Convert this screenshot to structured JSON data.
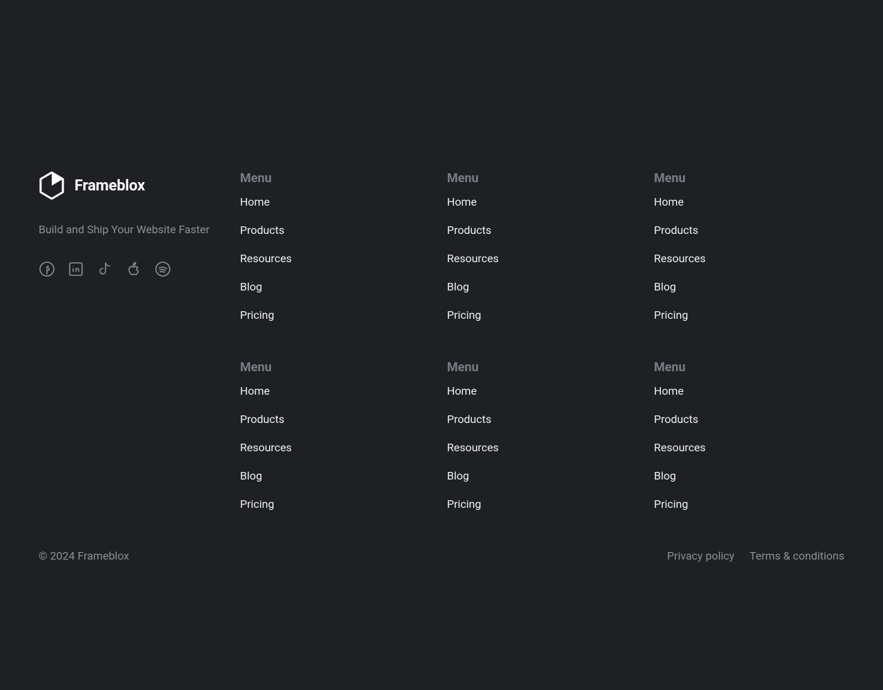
{
  "brand": {
    "name": "Frameblox",
    "tagline": "Build and Ship Your Website Faster"
  },
  "social": {
    "facebook_aria": "Facebook",
    "linkedin_aria": "LinkedIn",
    "tiktok_aria": "TikTok",
    "apple_aria": "Apple",
    "spotify_aria": "Spotify"
  },
  "menus": [
    {
      "title": "Menu",
      "items": [
        "Home",
        "Products",
        "Resources",
        "Blog",
        "Pricing"
      ]
    },
    {
      "title": "Menu",
      "items": [
        "Home",
        "Products",
        "Resources",
        "Blog",
        "Pricing"
      ]
    },
    {
      "title": "Menu",
      "items": [
        "Home",
        "Products",
        "Resources",
        "Blog",
        "Pricing"
      ]
    },
    {
      "title": "Menu",
      "items": [
        "Home",
        "Products",
        "Resources",
        "Blog",
        "Pricing"
      ]
    },
    {
      "title": "Menu",
      "items": [
        "Home",
        "Products",
        "Resources",
        "Blog",
        "Pricing"
      ]
    },
    {
      "title": "Menu",
      "items": [
        "Home",
        "Products",
        "Resources",
        "Blog",
        "Pricing"
      ]
    }
  ],
  "footer": {
    "copyright": "© 2024 Frameblox",
    "privacy": "Privacy policy",
    "terms": "Terms & conditions"
  }
}
